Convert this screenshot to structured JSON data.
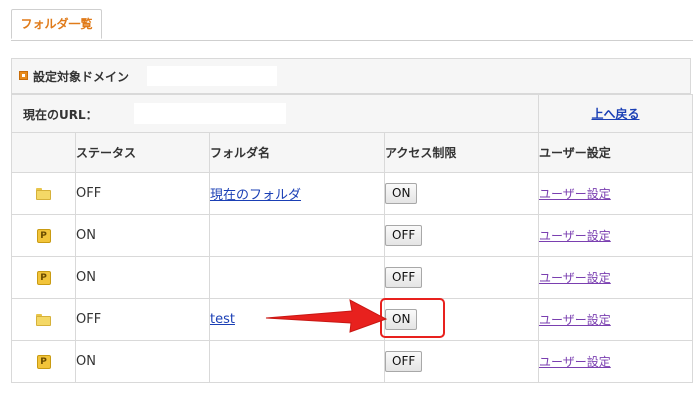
{
  "tabs": [
    {
      "label": "フォルダ一覧"
    }
  ],
  "domain": {
    "label": "設定対象ドメイン"
  },
  "url_row": {
    "label": "現在のURL：",
    "back_link": "上へ戻る"
  },
  "table": {
    "headers": [
      "",
      "ステータス",
      "フォルダ名",
      "アクセス制限",
      "ユーザー設定"
    ],
    "rows": [
      {
        "icon": "folder-icon",
        "status": "OFF",
        "folder": "現在のフォルダ",
        "access": "ON",
        "user": "ユーザー設定"
      },
      {
        "icon": "protected-folder-icon",
        "icon_text": "P",
        "status": "ON",
        "folder": "",
        "access": "OFF",
        "user": "ユーザー設定"
      },
      {
        "icon": "protected-folder-icon",
        "icon_text": "P",
        "status": "ON",
        "folder": "",
        "access": "OFF",
        "user": "ユーザー設定"
      },
      {
        "icon": "folder-icon",
        "status": "OFF",
        "folder": "test",
        "access": "ON",
        "user": "ユーザー設定"
      },
      {
        "icon": "protected-folder-icon",
        "icon_text": "P",
        "status": "ON",
        "folder": "",
        "access": "OFF",
        "user": "ユーザー設定"
      }
    ]
  },
  "colors": {
    "accent": "#e07b1a",
    "link": "#1a3fb5",
    "visited_link": "#7a3fb0",
    "highlight": "#e8211e"
  }
}
